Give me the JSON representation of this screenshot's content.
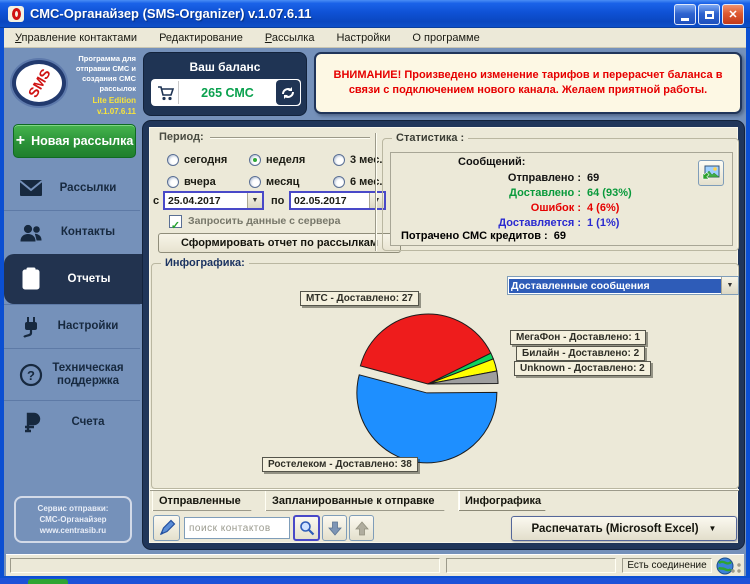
{
  "window": {
    "title": "СМС-Органайзер (SMS-Organizer) v.1.07.6.11"
  },
  "menu": {
    "items": [
      {
        "label": "Управление контактами",
        "underline": 0
      },
      {
        "label": "Редактирование",
        "underline": -1
      },
      {
        "label": "Рассылка",
        "underline": 0
      },
      {
        "label": "Настройки",
        "underline": -1
      },
      {
        "label": "О программе",
        "underline": -1
      }
    ]
  },
  "sidebar": {
    "logo_text": "SMS",
    "tagline": "Программа для\nотправки СМС и\nсоздания СМС\nрассылок",
    "edition": "Lite Edition",
    "version": "v.1.07.6.11",
    "new_button_plus": "+",
    "new_button": "Новая рассылка",
    "items": [
      {
        "label": "Рассылки",
        "active": false
      },
      {
        "label": "Контакты",
        "active": false
      },
      {
        "label": "Отчеты",
        "active": true
      },
      {
        "label": "Настройки",
        "active": false
      },
      {
        "label": "Техническая поддержка",
        "active": false
      },
      {
        "label": "Счета",
        "active": false
      }
    ],
    "footer": "Сервис отправки:\nСМС-Органайзер\nwww.centrasib.ru"
  },
  "balance": {
    "label": "Ваш баланс",
    "value": "265 СМС"
  },
  "notice": "ВНИМАНИЕ! Произведено изменение тарифов и перерасчет баланса в связи с подключением нового канала. Желаем приятной работы.",
  "period": {
    "label": "Период:",
    "radios": [
      {
        "label": "сегодня",
        "selected": false
      },
      {
        "label": "неделя",
        "selected": true
      },
      {
        "label": "3 мес.",
        "selected": false
      },
      {
        "label": "вчера",
        "selected": false
      },
      {
        "label": "месяц",
        "selected": false
      },
      {
        "label": "6 мес.",
        "selected": false
      }
    ],
    "from_label": "с",
    "from_value": "25.04.2017",
    "to_label": "по",
    "to_value": "02.05.2017",
    "checkbox_checked": true,
    "checkbox": "Запросить данные с сервера",
    "button": "Сформировать отчет по рассылкам"
  },
  "stats": {
    "title": "Статистика :",
    "header": "Сообщений:",
    "rows": [
      {
        "k": "Отправлено :",
        "v": "69",
        "color": "#141414"
      },
      {
        "k": "Доставлено :",
        "v": "64 (93%)",
        "color": "#0a9a3c"
      },
      {
        "k": "Ошибок :",
        "v": "4 (6%)",
        "color": "#e60000"
      },
      {
        "k": "Доставляется :",
        "v": "1 (1%)",
        "color": "#2a2ad0"
      }
    ],
    "footer_k": "Потрачено СМС кредитов :",
    "footer_v": "69"
  },
  "infographic": {
    "title": "Инфографика:",
    "combo_value": "Доставленные сообщения"
  },
  "chart_data": {
    "type": "pie",
    "title": "Доставленные сообщения",
    "start_angle_deg": -165,
    "legend_position": "tooltips",
    "series": [
      {
        "name": "МТС",
        "value": 27,
        "color": "#ee1c1c",
        "label": "МТС - Доставлено: 27",
        "exploded": false
      },
      {
        "name": "МегаФон",
        "value": 1,
        "color": "#0ed25e",
        "label": "МегаФон - Доставлено: 1",
        "exploded": false
      },
      {
        "name": "Билайн",
        "value": 2,
        "color": "#ffff00",
        "label": "Билайн - Доставлено: 2",
        "exploded": false
      },
      {
        "name": "Unknown",
        "value": 2,
        "color": "#9e9e9e",
        "label": "Unknown - Доставлено: 2",
        "exploded": false
      },
      {
        "name": "Ростелеком",
        "value": 38,
        "color": "#1e8fff",
        "label": "Ростелеком - Доставлено: 38",
        "exploded": true
      }
    ]
  },
  "tabs": [
    {
      "label": "Отправленные",
      "active": false
    },
    {
      "label": "Запланированные к отправке",
      "active": false
    },
    {
      "label": "Инфографика",
      "active": true
    }
  ],
  "toolbar": {
    "search_placeholder": "поиск контактов",
    "print_button": "Распечатать (Microsoft Excel)",
    "caret": "▼"
  },
  "statusbar": {
    "connection": "Есть соединение"
  },
  "combo_arrow": "▼"
}
